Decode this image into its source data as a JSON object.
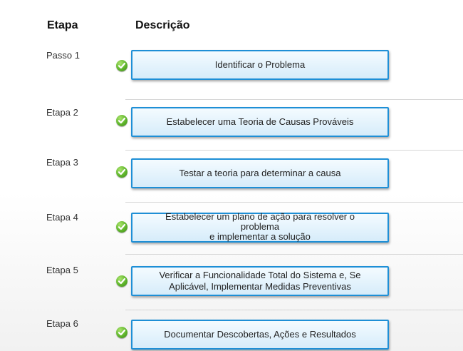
{
  "headers": {
    "step": "Etapa",
    "description": "Descrição"
  },
  "rows": [
    {
      "label": "Passo 1",
      "description": "Identificar o Problema"
    },
    {
      "label": "Etapa 2",
      "description": "Estabelecer uma Teoria de Causas Prováveis"
    },
    {
      "label": "Etapa 3",
      "description": "Testar a teoria para determinar a causa"
    },
    {
      "label": "Etapa 4",
      "description": "Estabelecer um plano de ação para resolver o\nproblema\ne implementar a solução"
    },
    {
      "label": "Etapa 5",
      "description": "Verificar a Funcionalidade Total do Sistema e, Se\nAplicável, Implementar Medidas Preventivas"
    },
    {
      "label": "Etapa 6",
      "description": "Documentar Descobertas, Ações e Resultados"
    }
  ],
  "colors": {
    "box_border": "#1e8fd6",
    "check_green": "#5fb52c"
  },
  "icons": {
    "status": "check-circle-icon"
  }
}
